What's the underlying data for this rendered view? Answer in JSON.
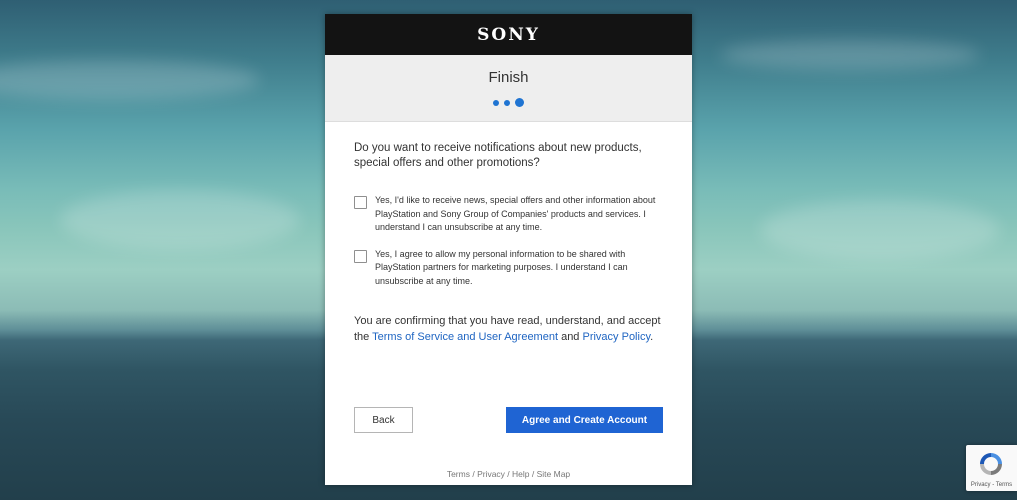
{
  "brand": {
    "logo_text": "SONY"
  },
  "step": {
    "title": "Finish",
    "total_steps": 3,
    "current_step": 3
  },
  "question": "Do you want to receive notifications about new products, special offers and other promotions?",
  "options": [
    {
      "label": "Yes, I'd like to receive news, special offers and other information about PlayStation and Sony Group of Companies' products and services. I understand I can unsubscribe at any time.",
      "checked": false
    },
    {
      "label": "Yes, I agree to allow my personal information to be shared with PlayStation partners for marketing purposes. I understand I can unsubscribe at any time.",
      "checked": false
    }
  ],
  "confirmation": {
    "prefix": "You are confirming that you have read, understand, and accept the ",
    "terms_link": "Terms of Service and User Agreement",
    "middle": " and ",
    "privacy_link": "Privacy Policy",
    "suffix": "."
  },
  "buttons": {
    "back": "Back",
    "submit": "Agree and Create Account"
  },
  "footer": {
    "terms": "Terms",
    "privacy": "Privacy",
    "help": "Help",
    "sitemap": "Site Map",
    "separator": " / "
  },
  "recaptcha": {
    "text": "Privacy - Terms"
  },
  "colors": {
    "accent": "#1f64d3",
    "brand_bar": "#131313",
    "link": "#1f65c2"
  }
}
